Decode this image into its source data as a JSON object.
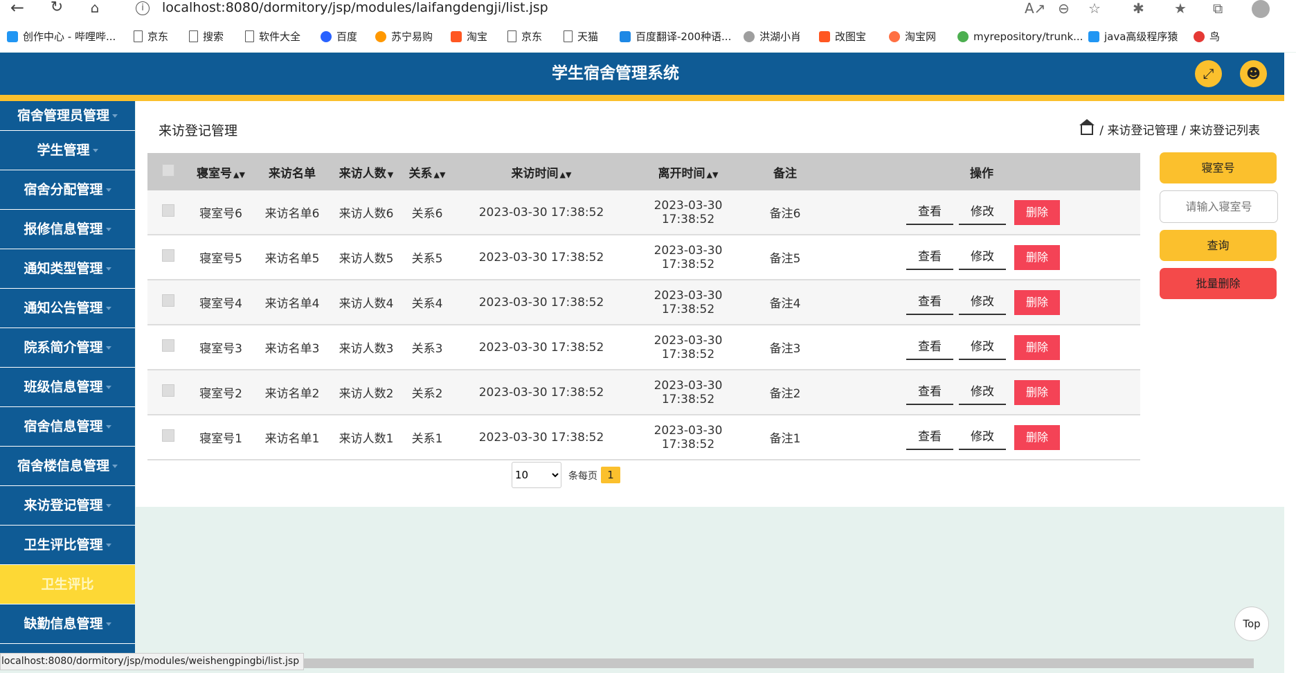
{
  "browser": {
    "url_host": "localhost",
    "url_rest": ":8080/dormitory/jsp/modules/laifangdengji/list.jsp",
    "bookmarks": [
      "创作中心 - 哔哩哔...",
      "京东",
      "搜索",
      "软件大全",
      "百度",
      "苏宁易购",
      "淘宝",
      "京东",
      "天猫",
      "百度翻译-200种语...",
      "洪湖小肖",
      "改图宝",
      "淘宝网",
      "myrepository/trunk...",
      "java高级程序猿",
      "鸟"
    ],
    "status_url": "localhost:8080/dormitory/jsp/modules/weishengpingbi/list.jsp"
  },
  "header": {
    "title": "学生宿舍管理系统"
  },
  "sidebar": {
    "items": [
      {
        "label": "宿舍管理员管理"
      },
      {
        "label": "学生管理"
      },
      {
        "label": "宿舍分配管理"
      },
      {
        "label": "报修信息管理"
      },
      {
        "label": "通知类型管理"
      },
      {
        "label": "通知公告管理"
      },
      {
        "label": "院系简介管理"
      },
      {
        "label": "班级信息管理"
      },
      {
        "label": "宿舍信息管理"
      },
      {
        "label": "宿舍楼信息管理"
      },
      {
        "label": "来访登记管理"
      },
      {
        "label": "卫生评比管理"
      },
      {
        "label": "卫生评比"
      },
      {
        "label": "缺勤信息管理"
      }
    ]
  },
  "main": {
    "title": "来访登记管理",
    "breadcrumb": {
      "level1": "来访登记管理",
      "level2": "来访登记列表"
    },
    "columns": [
      "寝室号",
      "来访名单",
      "来访人数",
      "关系",
      "来访时间",
      "离开时间",
      "备注",
      "操作"
    ],
    "rows": [
      [
        "寝室号6",
        "来访名单6",
        "来访人数6",
        "关系6",
        "2023-03-30 17:38:52",
        "2023-03-30 17:38:52",
        "备注6"
      ],
      [
        "寝室号5",
        "来访名单5",
        "来访人数5",
        "关系5",
        "2023-03-30 17:38:52",
        "2023-03-30 17:38:52",
        "备注5"
      ],
      [
        "寝室号4",
        "来访名单4",
        "来访人数4",
        "关系4",
        "2023-03-30 17:38:52",
        "2023-03-30 17:38:52",
        "备注4"
      ],
      [
        "寝室号3",
        "来访名单3",
        "来访人数3",
        "关系3",
        "2023-03-30 17:38:52",
        "2023-03-30 17:38:52",
        "备注3"
      ],
      [
        "寝室号2",
        "来访名单2",
        "来访人数2",
        "关系2",
        "2023-03-30 17:38:52",
        "2023-03-30 17:38:52",
        "备注2"
      ],
      [
        "寝室号1",
        "来访名单1",
        "来访人数1",
        "关系1",
        "2023-03-30 17:38:52",
        "2023-03-30 17:38:52",
        "备注1"
      ]
    ],
    "actions": {
      "view": "查看",
      "edit": "修改",
      "delete": "删除"
    },
    "pager": {
      "page_size": "10",
      "per_page_label": "条每页",
      "current_page": "1"
    }
  },
  "search_panel": {
    "field_label": "寝室号",
    "input_placeholder": "请输入寝室号",
    "query_button": "查询",
    "batch_delete_button": "批量删除"
  },
  "top_button": "Top",
  "colors": {
    "primary": "#0f5b95",
    "accent": "#fbc02d",
    "danger": "#f44356"
  }
}
